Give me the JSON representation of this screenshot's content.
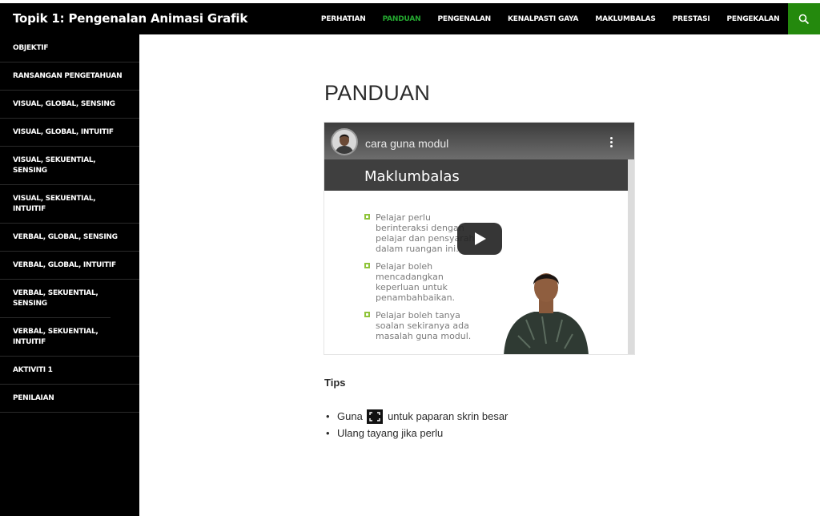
{
  "header": {
    "site_title": "Topik 1: Pengenalan Animasi Grafik",
    "nav": [
      {
        "label": "PERHATIAN",
        "active": false
      },
      {
        "label": "PANDUAN",
        "active": true
      },
      {
        "label": "PENGENALAN",
        "active": false
      },
      {
        "label": "KENALPASTI GAYA",
        "active": false
      },
      {
        "label": "MAKLUMBALAS",
        "active": false
      },
      {
        "label": "PRESTASI",
        "active": false
      },
      {
        "label": "PENGEKALAN",
        "active": false
      }
    ],
    "search_icon": "search-icon",
    "colors": {
      "bar": "#000000",
      "active": "#24a830",
      "search_bg": "#24890d"
    }
  },
  "sidebar": {
    "items": [
      {
        "label": "OBJEKTIF"
      },
      {
        "label": "RANSANGAN PENGETAHUAN"
      },
      {
        "label": "VISUAL, GLOBAL, SENSING"
      },
      {
        "label": "VISUAL, GLOBAL, INTUITIF"
      },
      {
        "label": "VISUAL, SEKUENTIAL, SENSING"
      },
      {
        "label": "VISUAL, SEKUENTIAL, INTUITIF"
      },
      {
        "label": "VERBAL, GLOBAL, SENSING"
      },
      {
        "label": "VERBAL, GLOBAL, INTUITIF"
      },
      {
        "label": "VERBAL, SEKUENTIAL, SENSING"
      },
      {
        "label": "VERBAL, SEKUENTIAL, INTUITIF"
      },
      {
        "label": "AKTIVITI 1"
      },
      {
        "label": "PENILAIAN"
      }
    ]
  },
  "main": {
    "title": "PANDUAN",
    "video": {
      "title": "cara guna modul",
      "slide_heading": "Maklumbalas",
      "slide_bullets": [
        "Pelajar perlu\nberinteraksi dengan\npelajar dan pensyarah\ndalam ruangan ini.",
        "Pelajar boleh\nmencadangkan\nkeperluan untuk\npenambahbaikan.",
        "Pelajar boleh tanya\nsoalan sekiranya ada\nmasalah guna modul."
      ],
      "play_icon": "play-icon",
      "menu_icon": "more-vert-icon"
    },
    "tips": {
      "heading": "Tips",
      "item1_before": "Guna",
      "item1_after": "untuk paparan skrin besar",
      "item1_icon": "fullscreen-icon",
      "item2": "Ulang tayang jika perlu"
    }
  }
}
